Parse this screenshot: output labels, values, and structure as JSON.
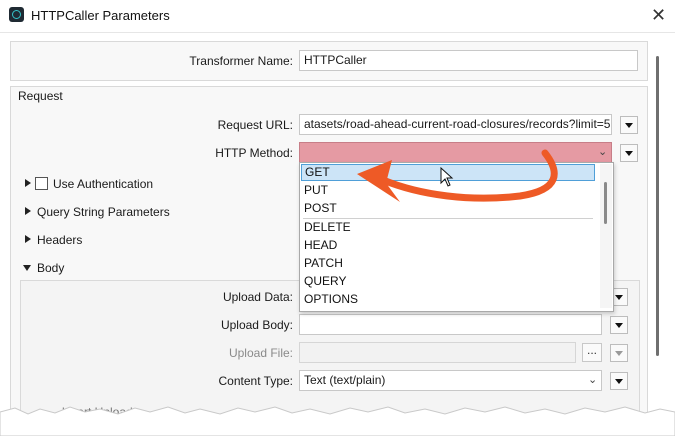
{
  "window": {
    "title": "HTTPCaller Parameters",
    "close_glyph": "✕"
  },
  "transformer": {
    "label": "Transformer Name:",
    "value": "HTTPCaller"
  },
  "request": {
    "group_label": "Request",
    "url_label": "Request URL:",
    "url_value": "atasets/road-ahead-current-road-closures/records?limit=5",
    "method_label": "HTTP Method:",
    "method_value": "",
    "method_options": [
      "GET",
      "PUT",
      "POST",
      "DELETE",
      "HEAD",
      "PATCH",
      "QUERY",
      "OPTIONS"
    ],
    "selected_option": "GET",
    "use_auth_label": "Use Authentication",
    "query_params_label": "Query String Parameters",
    "headers_label": "Headers"
  },
  "body": {
    "label": "Body",
    "upload_data_label": "Upload Data:",
    "upload_body_label": "Upload Body:",
    "upload_body_value": "",
    "upload_file_label": "Upload File:",
    "browse_label": "...",
    "content_type_label": "Content Type:",
    "content_type_value": "Text (text/plain)",
    "multipart_label": "ltipart Upload"
  },
  "colors": {
    "error_field": "#e59aa3",
    "arrow": "#ee5a26",
    "selection": "#cce4f7"
  }
}
